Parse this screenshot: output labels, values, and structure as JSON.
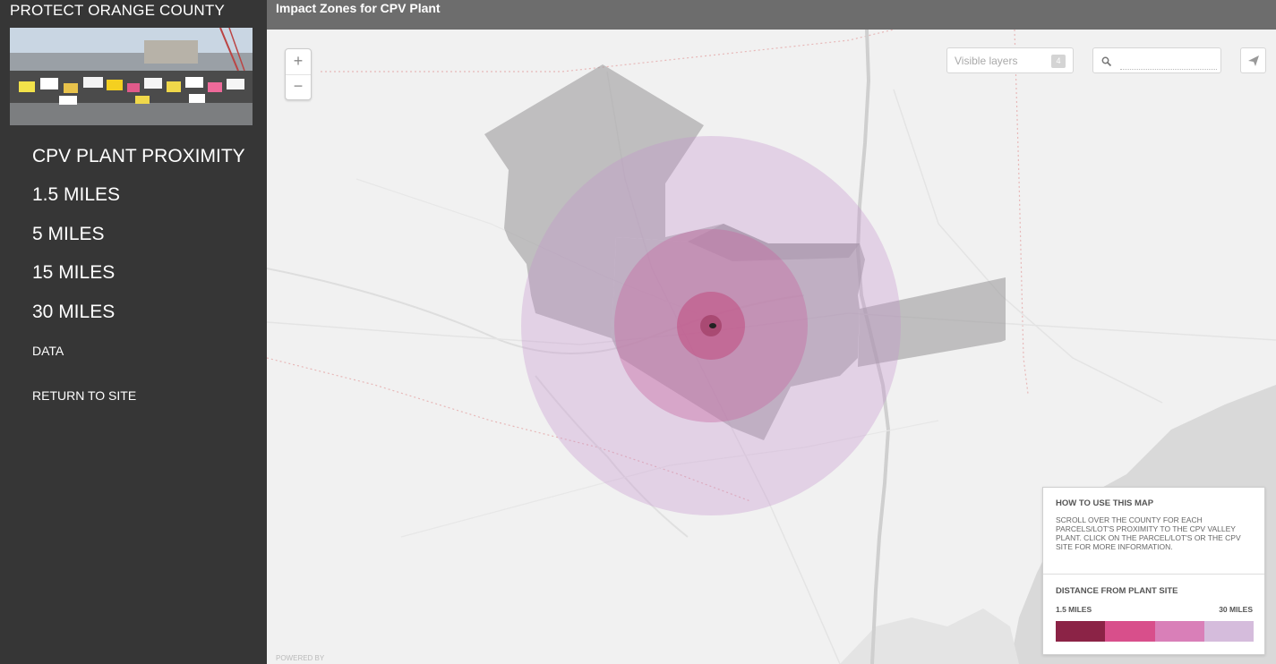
{
  "sidebar": {
    "site_title": "PROTECT ORANGE COUNTY",
    "nav": {
      "proximity": "CPV PLANT PROXIMITY",
      "mi_1_5": "1.5 MILES",
      "mi_5": "5 MILES",
      "mi_15": "15 MILES",
      "mi_30": "30 MILES",
      "data": "DATA",
      "return": "RETURN TO SITE"
    }
  },
  "map": {
    "title": "Impact Zones for CPV Plant",
    "zoom_in": "+",
    "zoom_out": "−",
    "layers_label": "Visible layers",
    "layers_count": "4",
    "search_placeholder": "",
    "attribution": "POWERED BY"
  },
  "legend": {
    "howto_title": "HOW TO USE THIS MAP",
    "howto_text": "SCROLL OVER THE COUNTY FOR EACH PARCELS/LOT'S PROXIMITY TO THE CPV VALLEY PLANT. CLICK ON THE PARCEL/LOT'S OR THE CPV SITE FOR MORE INFORMATION.",
    "distance_title": "DISTANCE FROM PLANT SITE",
    "min_label": "1.5 MILES",
    "max_label": "30 MILES",
    "colors": [
      "#8b2346",
      "#d84f8b",
      "#d97fb8",
      "#d5bcdc"
    ]
  },
  "icons": {
    "search": "search-icon",
    "share": "share-arrow-icon"
  }
}
